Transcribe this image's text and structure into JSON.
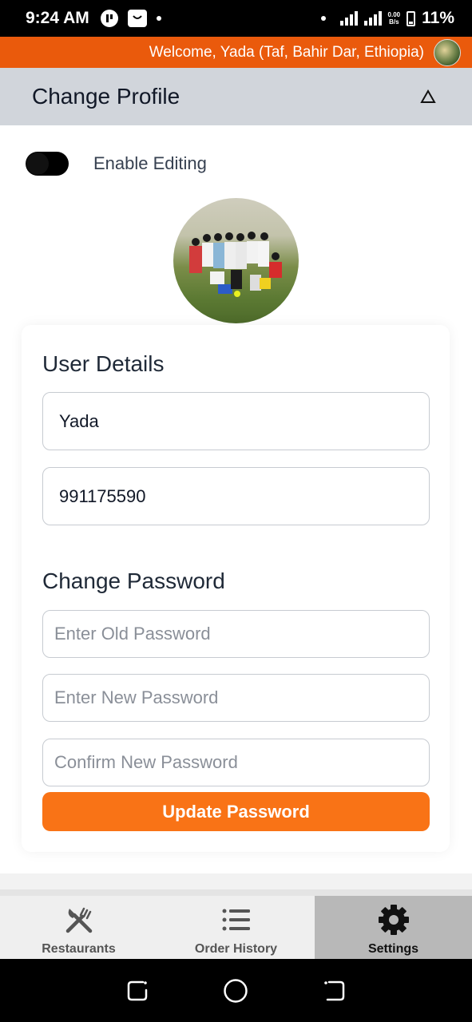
{
  "status_bar": {
    "time": "9:24 AM",
    "net_speed_value": "0.00",
    "net_speed_unit": "B/s",
    "battery": "11%"
  },
  "welcome": {
    "text": "Welcome, Yada (Taf, Bahir Dar, Ethiopia)"
  },
  "header": {
    "title": "Change Profile",
    "collapse_icon": "triangle-up-icon"
  },
  "editing": {
    "label": "Enable Editing",
    "enabled": false
  },
  "user_details": {
    "title": "User Details",
    "name": "Yada",
    "phone": "991175590"
  },
  "change_password": {
    "title": "Change Password",
    "old_placeholder": "Enter Old Password",
    "new_placeholder": "Enter New Password",
    "confirm_placeholder": "Confirm New Password",
    "button_label": "Update Password"
  },
  "bottom_nav": {
    "items": [
      {
        "label": "Restaurants",
        "icon": "fork-knife-icon",
        "active": false
      },
      {
        "label": "Order History",
        "icon": "list-icon",
        "active": false
      },
      {
        "label": "Settings",
        "icon": "gear-icon",
        "active": true
      }
    ]
  },
  "colors": {
    "accent": "#f97316",
    "welcome_bar": "#ea5a0c",
    "header_bg": "#d1d5db",
    "active_tab": "#b8b8b8"
  }
}
